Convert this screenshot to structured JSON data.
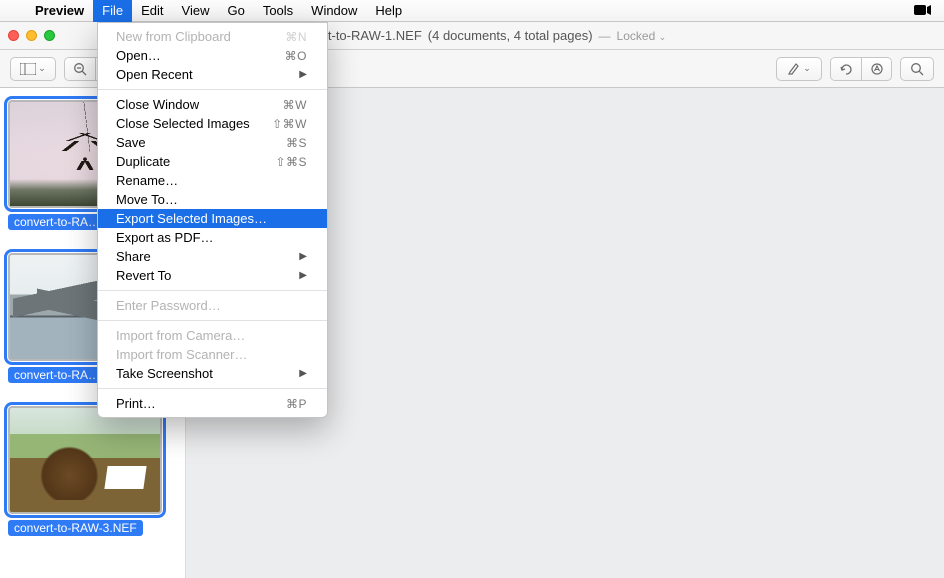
{
  "menubar": {
    "app": "Preview",
    "items": [
      "File",
      "Edit",
      "View",
      "Go",
      "Tools",
      "Window",
      "Help"
    ],
    "open_index": 0
  },
  "titlebar": {
    "filename": "convert-to-RAW-1.NEF",
    "detail": "(4 documents, 4 total pages)",
    "separator": "—",
    "locked": "Locked"
  },
  "file_menu": {
    "groups": [
      [
        {
          "label": "New from Clipboard",
          "shortcut": "⌘N",
          "disabled": true
        },
        {
          "label": "Open…",
          "shortcut": "⌘O"
        },
        {
          "label": "Open Recent",
          "submenu": true
        }
      ],
      [
        {
          "label": "Close Window",
          "shortcut": "⌘W"
        },
        {
          "label": "Close Selected Images",
          "shortcut": "⇧⌘W"
        },
        {
          "label": "Save",
          "shortcut": "⌘S"
        },
        {
          "label": "Duplicate",
          "shortcut": "⇧⌘S"
        },
        {
          "label": "Rename…"
        },
        {
          "label": "Move To…"
        },
        {
          "label": "Export Selected Images…",
          "highlight": true
        },
        {
          "label": "Export as PDF…"
        },
        {
          "label": "Share",
          "submenu": true
        },
        {
          "label": "Revert To",
          "submenu": true
        }
      ],
      [
        {
          "label": "Enter Password…",
          "disabled": true
        }
      ],
      [
        {
          "label": "Import from Camera…",
          "disabled": true
        },
        {
          "label": "Import from Scanner…",
          "disabled": true
        },
        {
          "label": "Take Screenshot",
          "submenu": true
        }
      ],
      [
        {
          "label": "Print…",
          "shortcut": "⌘P"
        }
      ]
    ]
  },
  "sidebar": {
    "thumbs": [
      {
        "label": "convert-to-RA…",
        "selected": true,
        "kind": "blossom"
      },
      {
        "label": "convert-to-RA…",
        "selected": true,
        "kind": "mountain"
      },
      {
        "label": "convert-to-RAW-3.NEF",
        "selected": true,
        "kind": "birdfield"
      }
    ]
  }
}
